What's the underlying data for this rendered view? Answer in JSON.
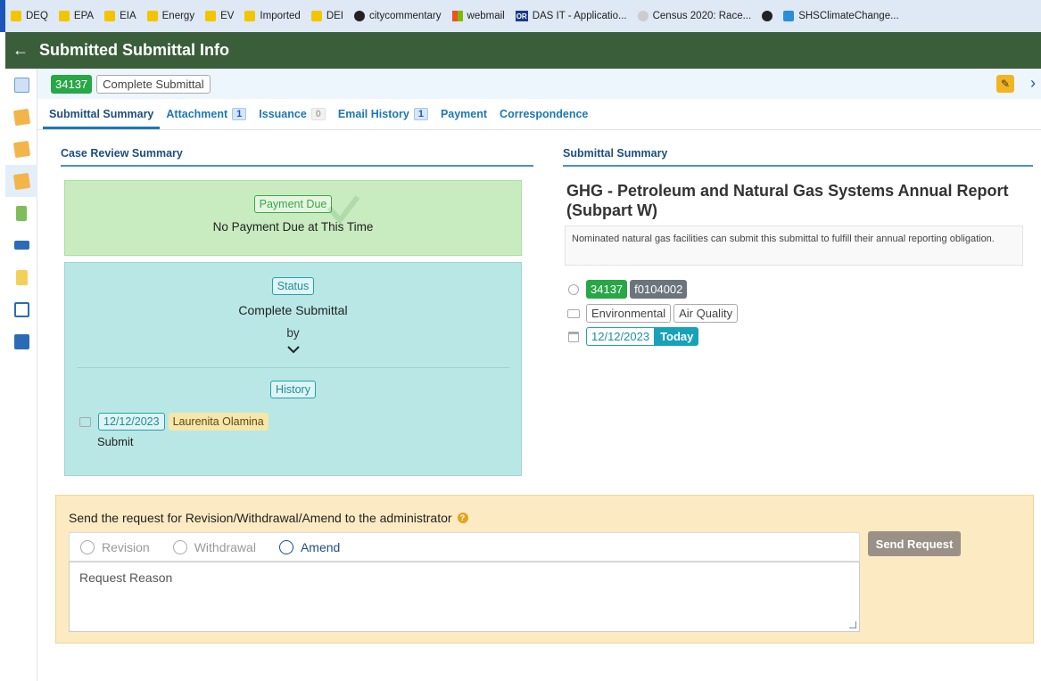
{
  "bookmarks": [
    {
      "label": "DEQ",
      "icon": "folder-icon"
    },
    {
      "label": "EPA",
      "icon": "folder-icon"
    },
    {
      "label": "EIA",
      "icon": "folder-icon"
    },
    {
      "label": "Energy",
      "icon": "folder-icon"
    },
    {
      "label": "EV",
      "icon": "folder-icon"
    },
    {
      "label": "Imported",
      "icon": "folder-icon"
    },
    {
      "label": "DEI",
      "icon": "folder-icon"
    },
    {
      "label": "citycommentary",
      "icon": "globe-icon"
    },
    {
      "label": "webmail",
      "icon": "microsoft-icon"
    },
    {
      "label": "DAS IT - Applicatio...",
      "icon": "oregon-icon"
    },
    {
      "label": "Census 2020: Race...",
      "icon": "census-icon"
    },
    {
      "label": "",
      "icon": "globe-icon"
    },
    {
      "label": "SHSClimateChange...",
      "icon": "shs-icon"
    }
  ],
  "header": {
    "title": "Submitted Submittal Info"
  },
  "strip": {
    "id": "34137",
    "status": "Complete Submittal"
  },
  "tabs": [
    {
      "label": "Submittal Summary",
      "count": null
    },
    {
      "label": "Attachment",
      "count": "1"
    },
    {
      "label": "Issuance",
      "count": "0"
    },
    {
      "label": "Email History",
      "count": "1"
    },
    {
      "label": "Payment",
      "count": null
    },
    {
      "label": "Correspondence",
      "count": null
    }
  ],
  "case_review": {
    "heading": "Case Review Summary",
    "payment_label": "Payment Due",
    "payment_text": "No Payment Due at This Time",
    "status_label": "Status",
    "status_text": "Complete Submittal",
    "by_text": "by",
    "history_label": "History",
    "history_date": "12/12/2023",
    "history_name": "Laurenita Olamina",
    "history_action": "Submit"
  },
  "summary": {
    "heading": "Submittal Summary",
    "title": "GHG - Petroleum and Natural Gas Systems Annual Report (Subpart W)",
    "description": "Nominated natural gas facilities can submit this submittal to fulfill their annual reporting obligation.",
    "id": "34137",
    "code": "f0104002",
    "category": "Environmental",
    "subcategory": "Air Quality",
    "date": "12/12/2023",
    "today_label": "Today"
  },
  "request": {
    "title": "Send the request for Revision/Withdrawal/Amend to the administrator",
    "options": [
      "Revision",
      "Withdrawal",
      "Amend"
    ],
    "reason_placeholder": "Request Reason",
    "send_label": "Send Request"
  },
  "colors": {
    "header": "#3b5e3a",
    "accent": "#1c78b5",
    "success": "#27a745",
    "warning": "#f1b521"
  }
}
